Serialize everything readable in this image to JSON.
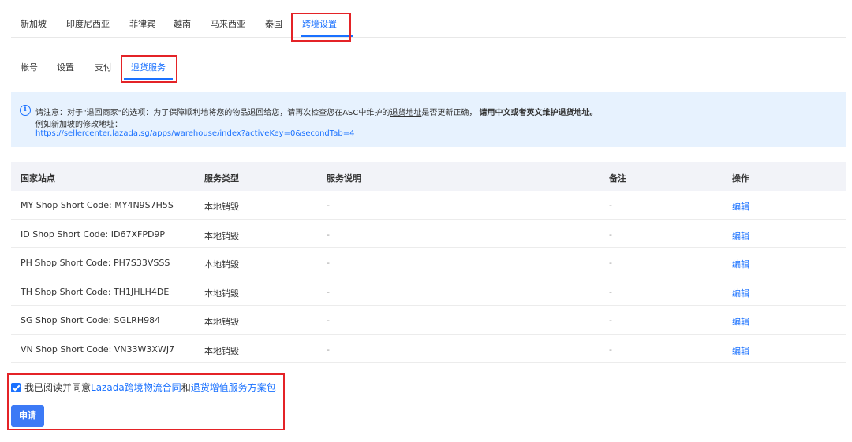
{
  "country_tabs": [
    "新加坡",
    "印度尼西亚",
    "菲律宾",
    "越南",
    "马来西亚",
    "泰国",
    "跨境设置"
  ],
  "sub_tabs": [
    "帐号",
    "设置",
    "支付",
    "退货服务"
  ],
  "notice": {
    "line1_a": "请注意：对于\"退回商家\"的选项：为了保障顺利地将您的物品退回给您，请再次检查您在ASC中维护的",
    "line1_link": "退货地址",
    "line1_b": "是否更新正确，",
    "line1_bold": "请用中文或者英文维护退货地址。",
    "line2": "例如新加坡的修改地址：",
    "line3": "https://sellercenter.lazada.sg/apps/warehouse/index?activeKey=0&secondTab=4"
  },
  "table": {
    "headers": [
      "国家站点",
      "服务类型",
      "服务说明",
      "备注",
      "操作"
    ],
    "rows": [
      {
        "site": "MY Shop Short Code: MY4N9S7H5S",
        "type": "本地销毁",
        "desc": "-",
        "note": "-",
        "action": "编辑"
      },
      {
        "site": "ID Shop Short Code: ID67XFPD9P",
        "type": "本地销毁",
        "desc": "-",
        "note": "-",
        "action": "编辑"
      },
      {
        "site": "PH Shop Short Code: PH7S33VSSS",
        "type": "本地销毁",
        "desc": "-",
        "note": "-",
        "action": "编辑"
      },
      {
        "site": "TH Shop Short Code: TH1JHLH4DE",
        "type": "本地销毁",
        "desc": "-",
        "note": "-",
        "action": "编辑"
      },
      {
        "site": "SG Shop Short Code: SGLRH984",
        "type": "本地销毁",
        "desc": "-",
        "note": "-",
        "action": "编辑"
      },
      {
        "site": "VN Shop Short Code: VN33W3XWJ7",
        "type": "本地销毁",
        "desc": "-",
        "note": "-",
        "action": "编辑"
      }
    ]
  },
  "agreement": {
    "prefix": "我已阅读并同意",
    "link1": "Lazada跨境物流合同",
    "and": "和",
    "link2": "退货增值服务方案包"
  },
  "apply_label": "申请",
  "colors": {
    "accent": "#1a71ff",
    "highlight": "#e42327",
    "notice_bg": "#e7f2fe"
  }
}
